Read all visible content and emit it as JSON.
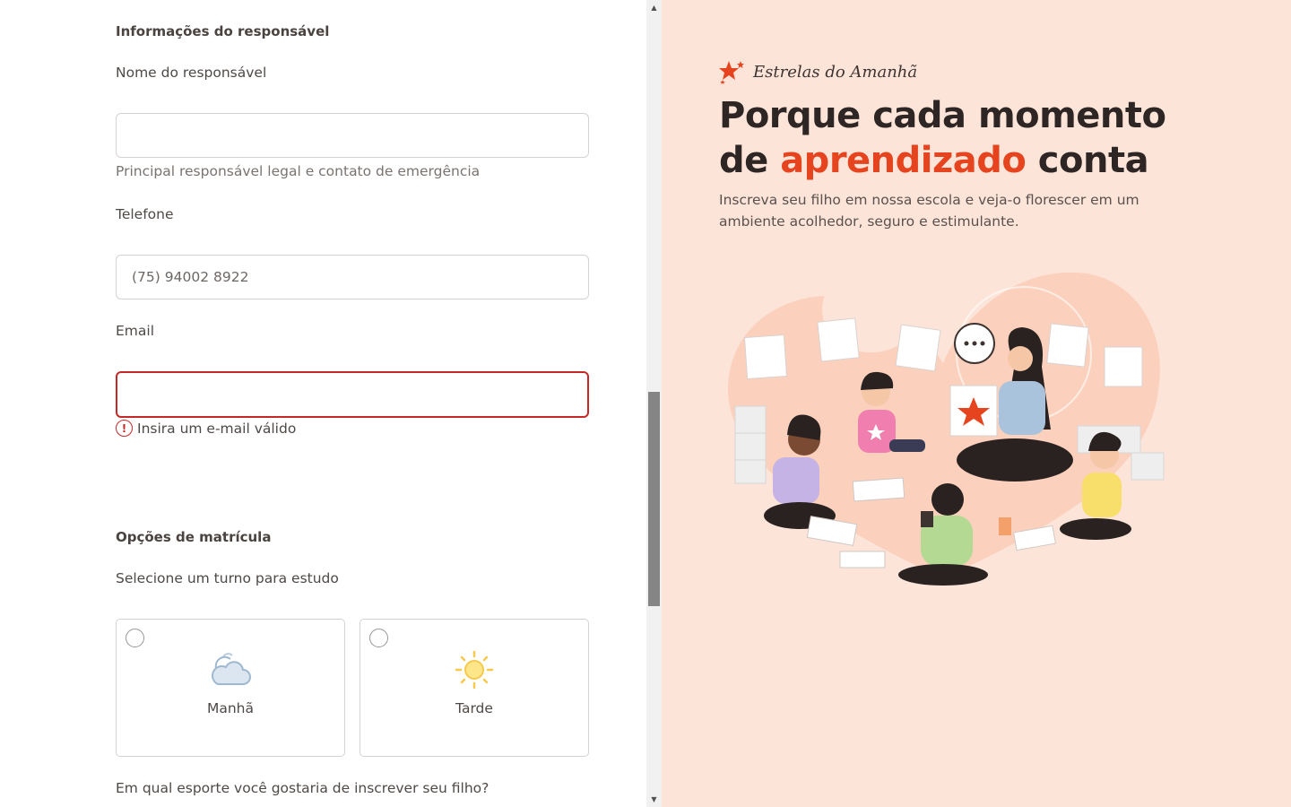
{
  "form": {
    "guardian_section_title": "Informações do responsável",
    "guardian_name": {
      "label": "Nome do responsável",
      "value": "",
      "helper": "Principal responsável legal e contato de emergência"
    },
    "phone": {
      "label": "Telefone",
      "placeholder": "(75) 94002 8922",
      "value": ""
    },
    "email": {
      "label": "Email",
      "value": "",
      "error": "Insira um e-mail válido",
      "error_icon": "!"
    },
    "enrollment_section_title": "Opções de matrícula",
    "shift": {
      "label": "Selecione um turno para estudo",
      "options": [
        {
          "label": "Manhã",
          "icon": "cloud-icon",
          "selected": false
        },
        {
          "label": "Tarde",
          "icon": "sun-icon",
          "selected": false
        }
      ]
    },
    "sport_question": "Em qual esporte você gostaria de inscrever seu filho?"
  },
  "scrollbar": {
    "up_arrow": "▲",
    "down_arrow": "▼"
  },
  "hero": {
    "brand_name": "Estrelas do Amanhã",
    "headline_part1": "Porque cada momento de ",
    "headline_accent": "aprendizado",
    "headline_part2": " conta",
    "subtitle": "Inscreva seu filho em nossa escola e veja-o florescer em um ambiente acolhedor, seguro e estimulante.",
    "illustration_alt": "teacher-and-children-illustration"
  },
  "colors": {
    "accent": "#e5441e",
    "hero_bg": "#fde4d9",
    "error": "#c62828",
    "border": "#d6d2cf"
  }
}
